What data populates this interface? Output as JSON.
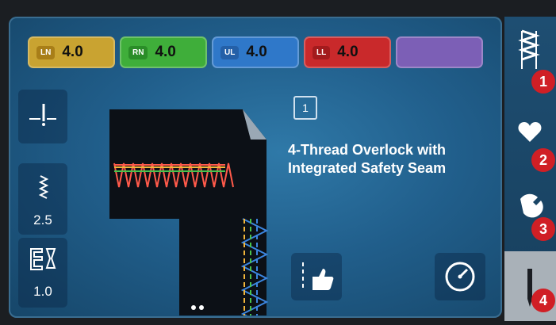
{
  "tensions": [
    {
      "tag": "LN",
      "value": "4.0",
      "bg": "#c9a331",
      "tagbg": "#a87e18"
    },
    {
      "tag": "RN",
      "value": "4.0",
      "bg": "#3fae3a",
      "tagbg": "#2a8d28"
    },
    {
      "tag": "UL",
      "value": "4.0",
      "bg": "#2f78c9",
      "tagbg": "#2460a8"
    },
    {
      "tag": "LL",
      "value": "4.0",
      "bg": "#c9292b",
      "tagbg": "#a31b1d"
    }
  ],
  "stitch": {
    "number": "1",
    "title": "4-Thread Overlock with Integrated Safety Seam"
  },
  "settings": {
    "stitch_length": "2.5",
    "differential_feed": "1.0"
  },
  "badges": [
    "1",
    "2",
    "3",
    "4"
  ],
  "colors": {
    "accent_red": "#d01f25",
    "screen": "#215f8c"
  }
}
